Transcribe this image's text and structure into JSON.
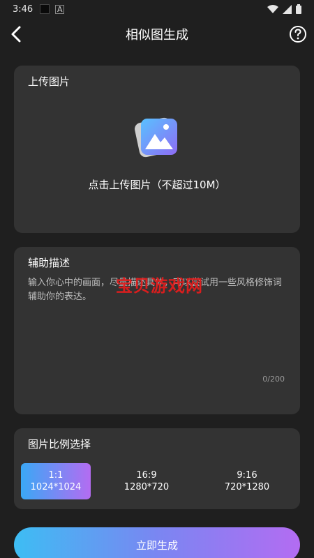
{
  "status_bar": {
    "time": "3:46",
    "indicator_a": "A"
  },
  "header": {
    "title": "相似图生成",
    "back_icon": "chevron-left-icon",
    "help_icon": "question-circle-icon"
  },
  "upload": {
    "title": "上传图片",
    "hint": "点击上传图片（不超过10M）",
    "icon": "image-upload-icon"
  },
  "description": {
    "title": "辅助描述",
    "placeholder": "输入你心中的画面，尽量描述具体，可以尝试用一些风格修饰词辅助你的表达。",
    "watermark": "宝贝游戏网",
    "counter": "0/200"
  },
  "ratio": {
    "title": "图片比例选择",
    "options": [
      {
        "ratio": "1:1",
        "size": "1024*1024",
        "selected": true
      },
      {
        "ratio": "16:9",
        "size": "1280*720",
        "selected": false
      },
      {
        "ratio": "9:16",
        "size": "720*1280",
        "selected": false
      }
    ]
  },
  "generate_button": {
    "label": "立即生成"
  },
  "colors": {
    "background": "#1f1f1f",
    "card": "#333333",
    "accent_start": "#3dbdf3",
    "accent_end": "#b36cf2"
  }
}
